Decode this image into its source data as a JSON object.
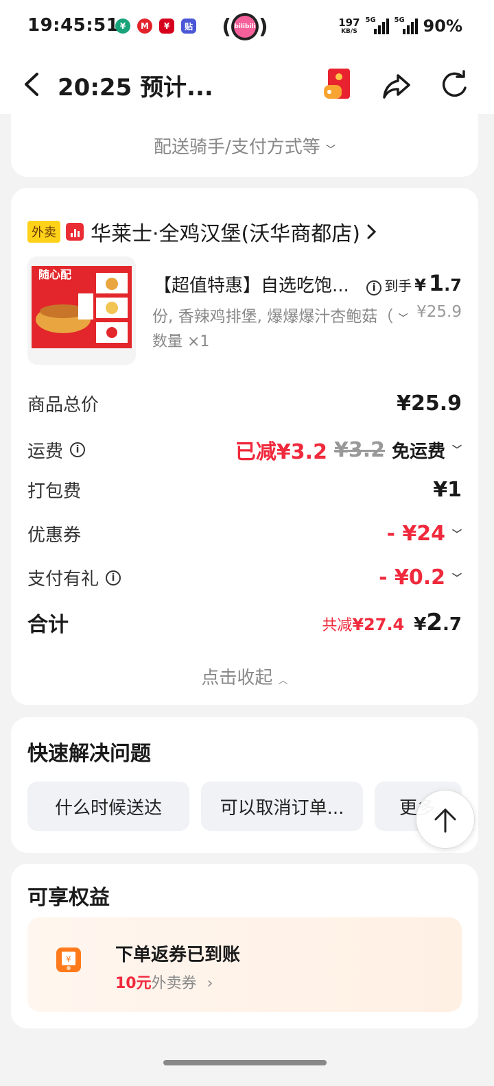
{
  "status_bar": {
    "time": "19:45:51",
    "net_speed_top": "197",
    "net_speed_bottom": "KB/S",
    "sim1": "5G",
    "sim2": "5G",
    "battery": "90%",
    "app_icons": [
      "bank-icon",
      "metro-icon",
      "bank2-icon",
      "tie-icon"
    ],
    "bili_label": "bilibili"
  },
  "header": {
    "title": "20:25 预计..."
  },
  "delivery_more": {
    "label": "配送骑手/支付方式等"
  },
  "order": {
    "tag": "外卖",
    "shop_name": "华莱士·全鸡汉堡(沃华商都店)",
    "product": {
      "title": "【超值特惠】自选吃饱...",
      "final_label": "到手",
      "currency": "¥",
      "final_int": "1",
      "final_dec": ".7",
      "spec": "份, 香辣鸡排堡, 爆爆爆汁杏鲍菇（",
      "orig_price": "¥25.9",
      "qty": "数量 ×1",
      "image_text": "随心配"
    },
    "fees": {
      "subtotal_label": "商品总价",
      "subtotal_value": "¥25.9",
      "delivery_label": "运费",
      "delivery_reduced": "已减¥3.2",
      "delivery_orig": "¥3.2",
      "delivery_free": "免运费",
      "packing_label": "打包费",
      "packing_value": "¥1",
      "coupon_label": "优惠券",
      "coupon_value": "- ¥24",
      "paygift_label": "支付有礼",
      "paygift_value": "- ¥0.2",
      "total_label": "合计",
      "total_save_prefix": "共减",
      "total_save": "¥27.4",
      "total_currency": "¥",
      "total_int": "2",
      "total_dec": ".7"
    },
    "collapse_label": "点击收起"
  },
  "quick_solve": {
    "title": "快速解决问题",
    "buttons": [
      "什么时候送达",
      "可以取消订单...",
      "更多"
    ]
  },
  "benefits": {
    "title": "可享权益",
    "main": "下单返券已到账",
    "amount": "10元",
    "type": "外卖券"
  },
  "colors": {
    "accent_red": "#f0293c",
    "tag_yellow": "#ffd21a",
    "bg": "#f3f3f3"
  }
}
